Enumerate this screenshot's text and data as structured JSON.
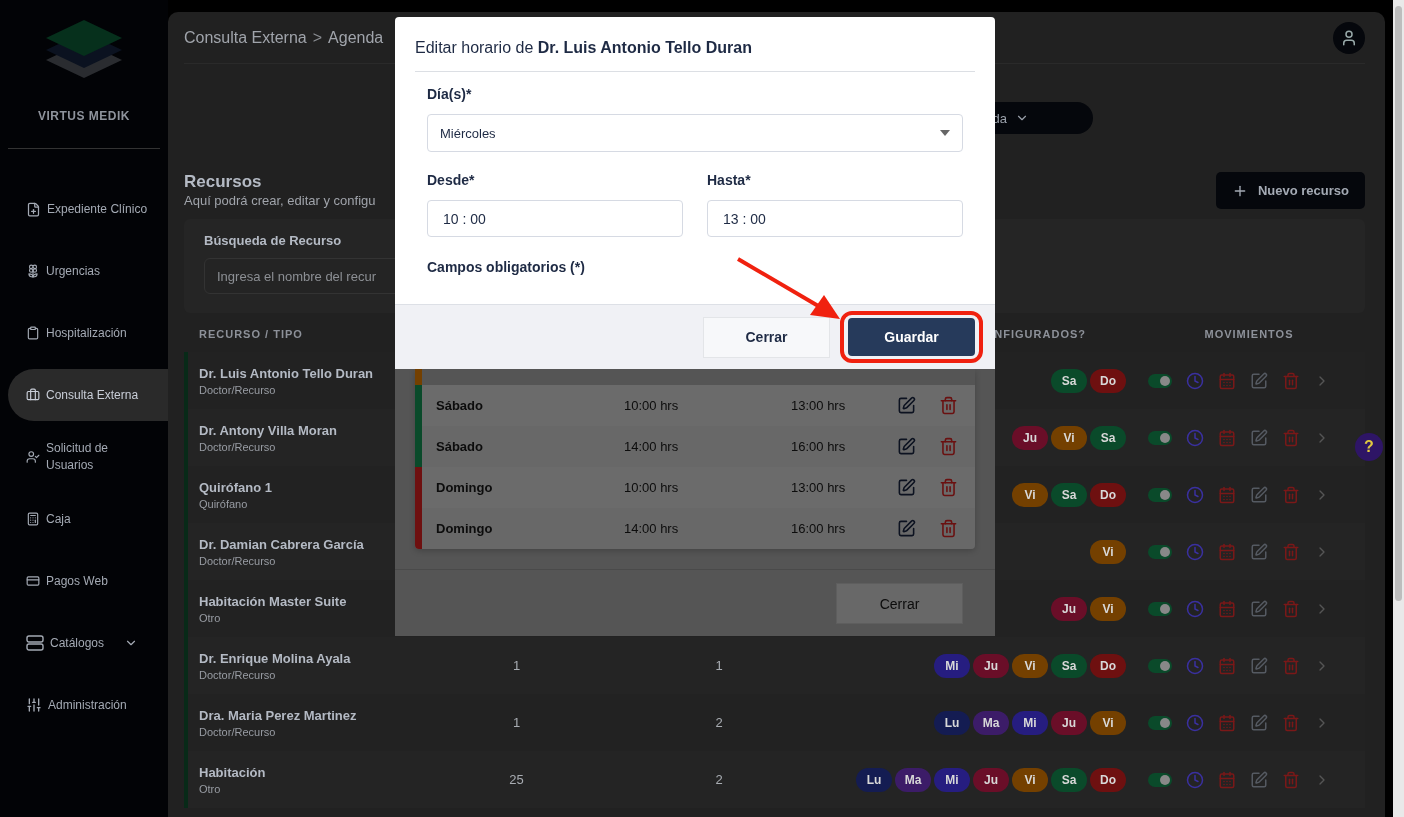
{
  "sidebar": {
    "brand": "VIRTUS MEDIK",
    "items": [
      {
        "label": "Expediente Clínico",
        "kind": "link",
        "selected": false
      },
      {
        "label": "Urgencias",
        "kind": "link",
        "selected": false
      },
      {
        "label": "Hospitalización",
        "kind": "link",
        "selected": false
      },
      {
        "label": "Consulta Externa",
        "kind": "link",
        "selected": true
      },
      {
        "label": "Solicitud de Usuarios",
        "kind": "link",
        "selected": false
      },
      {
        "label": "Caja",
        "kind": "link",
        "selected": false
      },
      {
        "label": "Pagos Web",
        "kind": "link",
        "selected": false
      },
      {
        "label": "Catálogos",
        "kind": "group",
        "selected": false
      },
      {
        "label": "Administración",
        "kind": "link",
        "selected": false
      }
    ]
  },
  "breadcrumb": [
    "Consulta Externa",
    "Agenda"
  ],
  "breadcrumb_separator": ">",
  "view_menu": {
    "label": "da"
  },
  "section": {
    "title": "Recursos",
    "subtitle": "Aquí podrá crear, editar y configu",
    "new_button": "Nuevo recurso"
  },
  "search": {
    "label": "Búsqueda de Recurso",
    "placeholder": "Ingresa el nombre del recur"
  },
  "table": {
    "columns": [
      "RECURSO / TIPO",
      "NFIGURADOS?",
      "MOVIMIENTOS"
    ],
    "rows": [
      {
        "name": "Dr. Luis Antonio Tello Duran",
        "type": "Doctor/Recurso",
        "column_2": "",
        "column_3": "",
        "days": [
          {
            "label": "Sa",
            "color": "#0a4a2a"
          },
          {
            "label": "Do",
            "color": "#6e1010"
          }
        ],
        "active": true
      },
      {
        "name": "Dr. Antony Villa Moran",
        "type": "Doctor/Recurso",
        "column_2": "",
        "column_3": "",
        "days": [
          {
            "label": "Ju",
            "color": "#6a0e28"
          },
          {
            "label": "Vi",
            "color": "#744000"
          },
          {
            "label": "Sa",
            "color": "#0a4a2a"
          }
        ],
        "active": true
      },
      {
        "name": "Quirófano 1",
        "type": "Quirófano",
        "column_2": "",
        "column_3": "",
        "days": [
          {
            "label": "Vi",
            "color": "#744000"
          },
          {
            "label": "Sa",
            "color": "#0a4a2a"
          },
          {
            "label": "Do",
            "color": "#6e1010"
          }
        ],
        "active": true
      },
      {
        "name": "Dr. Damian Cabrera García",
        "type": "Doctor/Recurso",
        "column_2": "",
        "column_3": "",
        "days": [
          {
            "label": "Vi",
            "color": "#744000"
          }
        ],
        "active": true
      },
      {
        "name": "Habitación Master Suite",
        "type": "Otro",
        "column_2": "",
        "column_3": "",
        "days": [
          {
            "label": "Ju",
            "color": "#6a0e28"
          },
          {
            "label": "Vi",
            "color": "#744000"
          }
        ],
        "active": true
      },
      {
        "name": "Dr. Enrique Molina Ayala",
        "type": "Doctor/Recurso",
        "column_2": "1",
        "column_3": "1",
        "days": [
          {
            "label": "Mi",
            "color": "#261d80"
          },
          {
            "label": "Ju",
            "color": "#6a0e28"
          },
          {
            "label": "Vi",
            "color": "#744000"
          },
          {
            "label": "Sa",
            "color": "#0a4a2a"
          },
          {
            "label": "Do",
            "color": "#6e1010"
          }
        ],
        "active": true
      },
      {
        "name": "Dra. Maria Perez Martinez",
        "type": "Doctor/Recurso",
        "column_2": "1",
        "column_3": "2",
        "days": [
          {
            "label": "Lu",
            "color": "#141c52"
          },
          {
            "label": "Ma",
            "color": "#3c1c68"
          },
          {
            "label": "Mi",
            "color": "#261d80"
          },
          {
            "label": "Ju",
            "color": "#6a0e28"
          },
          {
            "label": "Vi",
            "color": "#744000"
          }
        ],
        "active": true
      },
      {
        "name": "Habitación",
        "type": "Otro",
        "column_2": "25",
        "column_3": "2",
        "days": [
          {
            "label": "Lu",
            "color": "#141c52"
          },
          {
            "label": "Ma",
            "color": "#3c1c68"
          },
          {
            "label": "Mi",
            "color": "#261d80"
          },
          {
            "label": "Ju",
            "color": "#6a0e28"
          },
          {
            "label": "Vi",
            "color": "#744000"
          },
          {
            "label": "Sa",
            "color": "#0a4a2a"
          },
          {
            "label": "Do",
            "color": "#6e1010"
          }
        ],
        "active": true
      }
    ]
  },
  "help_button": "?",
  "schedule_modal": {
    "rows": [
      {
        "day": "Sábado",
        "from": "10:00 hrs",
        "to": "13:00 hrs",
        "color": "#0a4a2a"
      },
      {
        "day": "Sábado",
        "from": "14:00 hrs",
        "to": "16:00 hrs",
        "color": "#0a4a2a"
      },
      {
        "day": "Domingo",
        "from": "10:00 hrs",
        "to": "13:00 hrs",
        "color": "#6e1010"
      },
      {
        "day": "Domingo",
        "from": "14:00 hrs",
        "to": "16:00 hrs",
        "color": "#6e1010"
      }
    ],
    "close_button": "Cerrar"
  },
  "edit_modal": {
    "title": "Editar horario de **Dr. Luis Antonio Tello Duran**",
    "days_label": "Día(s)*",
    "days_value": "Miércoles",
    "from_label": "Desde*",
    "from_value": "10 : 00",
    "to_label": "Hasta*",
    "to_value": "13 : 00",
    "required_note": "Campos obligatorios (*)",
    "close_button": "Cerrar",
    "save_button": "Guardar",
    "save_highlighted": true
  }
}
